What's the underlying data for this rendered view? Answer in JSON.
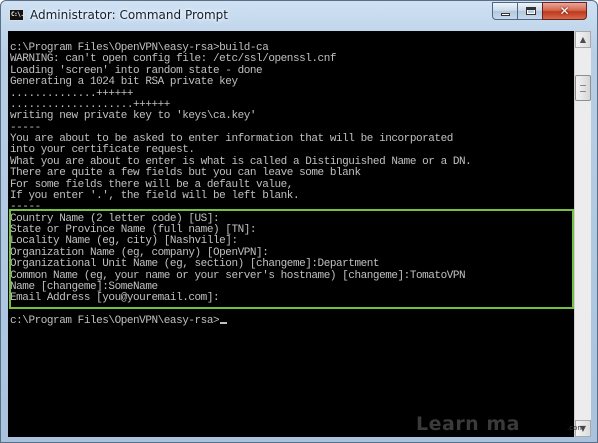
{
  "window": {
    "icon_text": "C:\\.",
    "title": "Administrator: Command Prompt",
    "controls": {
      "minimize": "",
      "maximize": "",
      "close": "✕"
    }
  },
  "console": {
    "lines": [
      "c:\\Program Files\\OpenVPN\\easy-rsa>build-ca",
      "WARNING: can't open config file: /etc/ssl/openssl.cnf",
      "Loading 'screen' into random state - done",
      "Generating a 1024 bit RSA private key",
      "..............++++++",
      "....................++++++",
      "writing new private key to 'keys\\ca.key'",
      "-----",
      "You are about to be asked to enter information that will be incorporated",
      "into your certificate request.",
      "What you are about to enter is what is called a Distinguished Name or a DN.",
      "There are quite a few fields but you can leave some blank",
      "For some fields there will be a default value,",
      "If you enter '.', the field will be left blank.",
      "-----",
      "Country Name (2 letter code) [US]:",
      "State or Province Name (full name) [TN]:",
      "Locality Name (eg, city) [Nashville]:",
      "Organization Name (eg, company) [OpenVPN]:",
      "Organizational Unit Name (eg, section) [changeme]:Department",
      "Common Name (eg, your name or your server's hostname) [changeme]:TomatoVPN",
      "Name [changeme]:SomeName",
      "Email Address [you@youremail.com]:",
      "",
      "c:\\Program Files\\OpenVPN\\easy-rsa>"
    ]
  },
  "highlight": {
    "color": "#74c043"
  },
  "watermark": {
    "text": "Learn   ma",
    "sub": ".com"
  }
}
